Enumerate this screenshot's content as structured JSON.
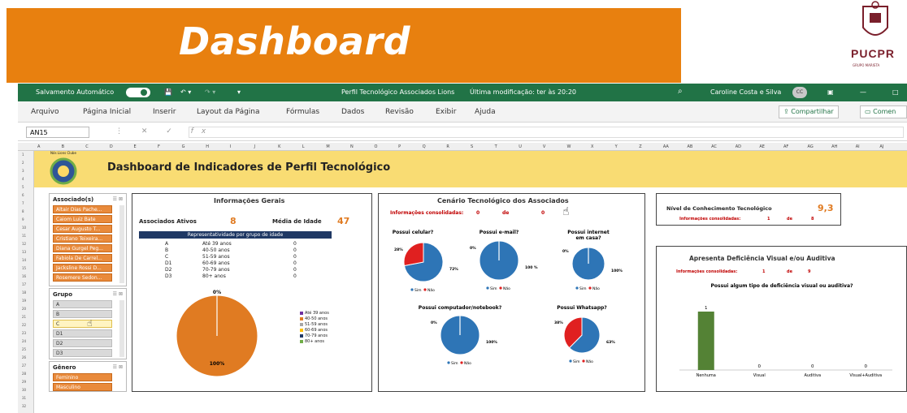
{
  "slide": {
    "title": "Dashboard",
    "logo_text": "PUCPR",
    "logo_sub": "GRUPO MARISTA",
    "colors": {
      "banner": "#e8800f",
      "logo": "#7a1f2b"
    }
  },
  "excel": {
    "autosave_label": "Salvamento Automático",
    "window_title": "Perfil Tecnológico Associados Lions",
    "modified": "Última modificação: ter às 20:20",
    "user_name": "Caroline Costa e Silva",
    "user_initials": "CC",
    "menu": [
      "Arquivo",
      "Página Inicial",
      "Inserir",
      "Layout da Página",
      "Fórmulas",
      "Dados",
      "Revisão",
      "Exibir",
      "Ajuda"
    ],
    "share_label": "Compartilhar",
    "comments_label": "Comen",
    "name_box": "AN15",
    "column_headers": [
      "A",
      "B",
      "C",
      "D",
      "E",
      "F",
      "G",
      "H",
      "I",
      "J",
      "K",
      "L",
      "M",
      "N",
      "O",
      "P",
      "Q",
      "R",
      "S",
      "T",
      "U",
      "V",
      "W",
      "X",
      "Y",
      "Z",
      "AA",
      "AB",
      "AC",
      "AD",
      "AE",
      "AF",
      "AG",
      "AH",
      "AI",
      "AJ"
    ],
    "colors": {
      "ribbon": "#217346",
      "yellow": "#f9dc73"
    }
  },
  "sheet": {
    "title": "Dashboard de Indicadores de Perfil Tecnológico",
    "logo_caption": "Nós Lions Clube"
  },
  "slicers": {
    "associados": {
      "title": "Associado(s)",
      "items": [
        "Altair Dias Pache...",
        "Caiom Luiz Bate",
        "Cesar Augusto T...",
        "Cristiano Teixeira...",
        "Diana Gurgel Peg...",
        "Fabiola De Carrel...",
        "Jacksline Rossi D...",
        "Rosemere Sedon..."
      ]
    },
    "grupo": {
      "title": "Grupo",
      "items": [
        "A",
        "B",
        "C",
        "D1",
        "D2",
        "D3"
      ],
      "selected": "C"
    },
    "genero": {
      "title": "Gênero",
      "items": [
        "Feminino",
        "Masculino"
      ]
    }
  },
  "info_gerais": {
    "title": "Informações Gerais",
    "ativos_label": "Associados Ativos",
    "ativos_value": "8",
    "media_label": "Média de Idade",
    "media_value": "47",
    "table_header": "Representatividade por grupo de idade",
    "rows": [
      {
        "g": "A",
        "range": "Até 39 anos",
        "v": "0"
      },
      {
        "g": "B",
        "range": "40-50 anos",
        "v": "0"
      },
      {
        "g": "C",
        "range": "51-59 anos",
        "v": "0"
      },
      {
        "g": "D1",
        "range": "60-69 anos",
        "v": "0"
      },
      {
        "g": "D2",
        "range": "70-79 anos",
        "v": "0"
      },
      {
        "g": "D3",
        "range": "80+ anos",
        "v": "0"
      }
    ],
    "pie_label": "100%",
    "pie_top_label": "0%",
    "legend": [
      {
        "label": "Até 39 anos",
        "color": "#7030a0"
      },
      {
        "label": "40-50 anos",
        "color": "#e07b22"
      },
      {
        "label": "51-59 anos",
        "color": "#a5a5a5"
      },
      {
        "label": "60-69 anos",
        "color": "#ffc000"
      },
      {
        "label": "70-79 anos",
        "color": "#203864"
      },
      {
        "label": "80+ anos",
        "color": "#70ad47"
      }
    ]
  },
  "cenario": {
    "title": "Cenário Tecnológico dos Associados",
    "info_label": "Informações consolidadas:",
    "info_n": "0",
    "info_de": "de",
    "info_total": "0",
    "legend_sim": "Sim",
    "legend_nao": "Não",
    "charts": [
      {
        "title": "Possui celular?",
        "sim_label": "72%",
        "nao_label": "28%"
      },
      {
        "title": "Possui e-mail?",
        "sim_label": "100 %",
        "nao_label": "0%"
      },
      {
        "title": "Possui internet em casa?",
        "sim_label": "100%",
        "nao_label": "0%"
      },
      {
        "title": "Possui computador/notebook?",
        "sim_label": "100%",
        "nao_label": "0%"
      },
      {
        "title": "Possui Whatsapp?",
        "sim_label": "63%",
        "nao_label": "38%"
      }
    ],
    "colors": {
      "sim": "#2e75b6",
      "nao": "#e02020"
    }
  },
  "conhecimento": {
    "label": "Nível de Conhecimento Tecnológico",
    "value": "9,3",
    "info_label": "Informações consolidadas:",
    "info_n": "1",
    "info_de": "de",
    "info_total": "8"
  },
  "deficiencia": {
    "title": "Apresenta Deficiência Visual e/ou Auditiva",
    "info_label": "Informações consolidadas:",
    "info_n": "1",
    "info_de": "de",
    "info_total": "9"
  },
  "chart_data": [
    {
      "type": "pie",
      "title": "",
      "categories": [
        "Até 39 anos",
        "40-50 anos",
        "51-59 anos",
        "60-69 anos",
        "70-79 anos",
        "80+ anos"
      ],
      "values": [
        0,
        100,
        0,
        0,
        0,
        0
      ]
    },
    {
      "type": "pie",
      "title": "Possui celular?",
      "categories": [
        "Sim",
        "Não"
      ],
      "values": [
        72,
        28
      ]
    },
    {
      "type": "pie",
      "title": "Possui e-mail?",
      "categories": [
        "Sim",
        "Não"
      ],
      "values": [
        100,
        0
      ]
    },
    {
      "type": "pie",
      "title": "Possui internet em casa?",
      "categories": [
        "Sim",
        "Não"
      ],
      "values": [
        100,
        0
      ]
    },
    {
      "type": "pie",
      "title": "Possui computador/notebook?",
      "categories": [
        "Sim",
        "Não"
      ],
      "values": [
        100,
        0
      ]
    },
    {
      "type": "pie",
      "title": "Possui Whatsapp?",
      "categories": [
        "Sim",
        "Não"
      ],
      "values": [
        63,
        38
      ]
    },
    {
      "type": "bar",
      "title": "Possui algum tipo de deficiência visual ou auditiva?",
      "categories": [
        "Nenhuma",
        "Visual",
        "Auditiva",
        "Visual+Auditiva"
      ],
      "values": [
        1,
        0,
        0,
        0
      ],
      "ylim": [
        0,
        1
      ],
      "color": "#548235"
    }
  ]
}
